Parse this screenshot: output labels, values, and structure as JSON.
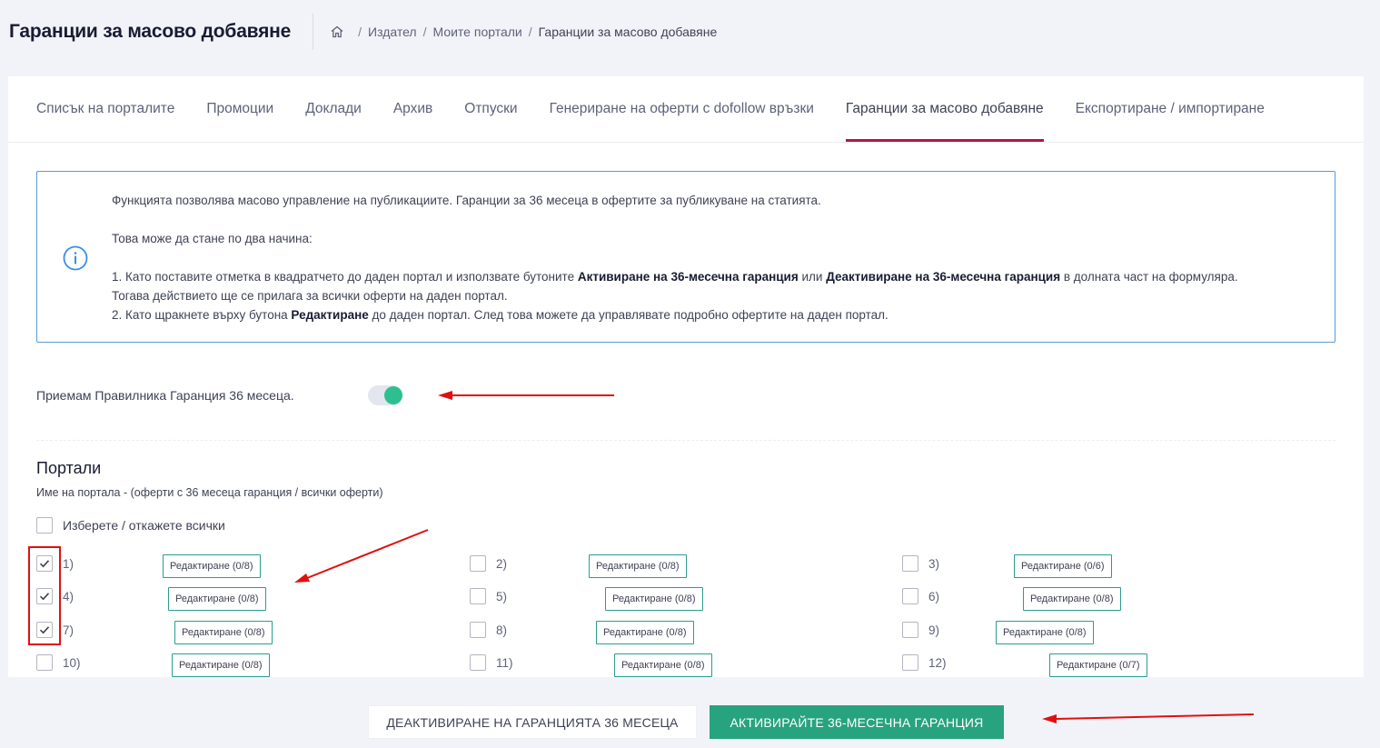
{
  "header": {
    "title": "Гаранции за масово добавяне",
    "breadcrumb": [
      "Издател",
      "Моите портали",
      "Гаранции за масово добавяне"
    ]
  },
  "tabs": [
    {
      "label": "Списък на порталите"
    },
    {
      "label": "Промоции"
    },
    {
      "label": "Доклади"
    },
    {
      "label": "Архив"
    },
    {
      "label": "Отпуски"
    },
    {
      "label": "Генериране на оферти с dofollow връзки"
    },
    {
      "label": "Гаранции за масово добавяне",
      "active": true
    },
    {
      "label": "Експортиране / импортиране"
    }
  ],
  "info": {
    "line1": "Функцията позволява масово управление на публикациите. Гаранции за 36 месеца в офертите за публикуване на статията.",
    "line2": "Това може да стане по два начина:",
    "line3_pre": "1. Като поставите отметка в квадратчето до даден портал и използвате бутоните ",
    "line3_b1": "Активиране на 36-месечна гаранция",
    "line3_mid": " или ",
    "line3_b2": "Деактивиране на 36-месечна гаранция",
    "line3_post": " в долната част на формуляра.",
    "line4": "Тогава действието ще се прилага за всички оферти на даден портал.",
    "line5_pre": "2. Като щракнете върху бутона ",
    "line5_b": "Редактиране",
    "line5_post": " до даден портал. След това можете да управлявате подробно офертите на даден портал."
  },
  "terms": {
    "label": "Приемам Правилника Гаранция 36 месеца.",
    "enabled": true
  },
  "portals_section": {
    "title": "Портали",
    "subtitle": "Име на портала - (оферти с 36 месеца гаранция / всички оферти)",
    "select_all_label": "Изберете / откажете всички",
    "items": [
      {
        "num": "1)",
        "checked": true,
        "edit": "Редактиране (0/8)"
      },
      {
        "num": "2)",
        "checked": false,
        "edit": "Редактиране (0/8)"
      },
      {
        "num": "3)",
        "checked": false,
        "edit": "Редактиране (0/6)"
      },
      {
        "num": "4)",
        "checked": true,
        "edit": "Редактиране (0/8)"
      },
      {
        "num": "5)",
        "checked": false,
        "edit": "Редактиране (0/8)"
      },
      {
        "num": "6)",
        "checked": false,
        "edit": "Редактиране (0/8)"
      },
      {
        "num": "7)",
        "checked": true,
        "edit": "Редактиране (0/8)"
      },
      {
        "num": "8)",
        "checked": false,
        "edit": "Редактиране (0/8)"
      },
      {
        "num": "9)",
        "checked": false,
        "edit": "Редактиране (0/8)"
      },
      {
        "num": "10)",
        "checked": false,
        "edit": "Редактиране (0/8)"
      },
      {
        "num": "11)",
        "checked": false,
        "edit": "Редактиране (0/8)"
      },
      {
        "num": "12)",
        "checked": false,
        "edit": "Редактиране (0/7)"
      }
    ]
  },
  "footer": {
    "deactivate_label": "ДЕАКТИВИРАНЕ НА ГАРАНЦИЯТА 36 МЕСЕЦА",
    "activate_label": "АКТИВИРАЙТЕ 36-МЕСЕЧНА ГАРАНЦИЯ"
  },
  "colors": {
    "accent_tab": "#b5173e",
    "toggle_on": "#2ebf91",
    "activate_button": "#28a37f",
    "edit_border": "#2a9d8f",
    "annotation_red": "#e01010",
    "info_border": "#5b9bd5"
  }
}
